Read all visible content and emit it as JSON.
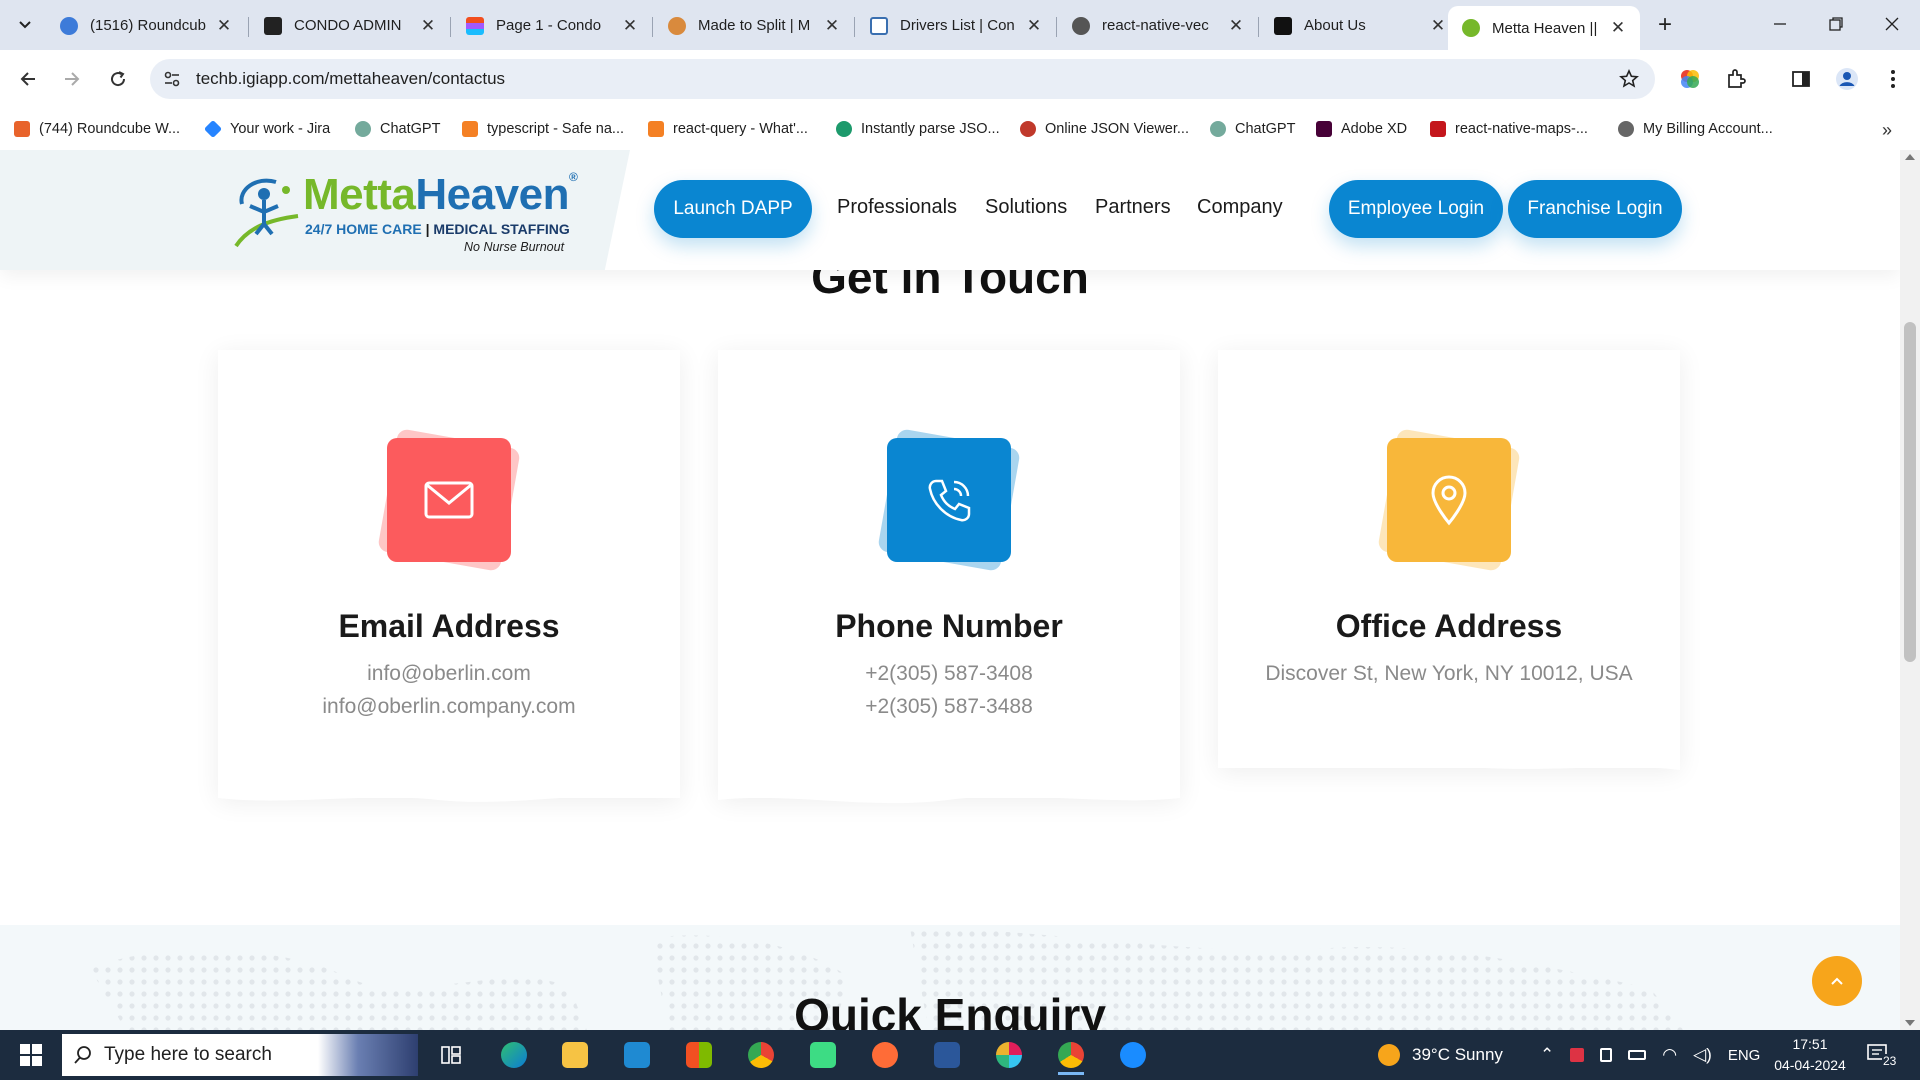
{
  "browser": {
    "tabs": [
      {
        "title": "(1516) Roundcub",
        "color": "#3d7bd9"
      },
      {
        "title": "CONDO ADMIN",
        "color": "#222222"
      },
      {
        "title": "Page 1 - Condo",
        "color": "#f24e1e"
      },
      {
        "title": "Made to Split | M",
        "color": "#d98a3d"
      },
      {
        "title": "Drivers List | Con",
        "color": "#3a6fb0"
      },
      {
        "title": "react-native-vec",
        "color": "#555555"
      },
      {
        "title": "About Us",
        "color": "#111111"
      },
      {
        "title": "Metta Heaven ||",
        "color": "#76b82a",
        "active": true
      }
    ],
    "url": "techb.igiapp.com/mettaheaven/contactus",
    "bookmarks": [
      {
        "label": "(744) Roundcube W...",
        "color": "#e8632b"
      },
      {
        "label": "Your work - Jira",
        "color": "#2684ff"
      },
      {
        "label": "ChatGPT",
        "color": "#74aa9c"
      },
      {
        "label": "typescript - Safe na...",
        "color": "#f48024"
      },
      {
        "label": "react-query - What'...",
        "color": "#f48024"
      },
      {
        "label": "Instantly parse JSO...",
        "color": "#1d9a6c"
      },
      {
        "label": "Online JSON Viewer...",
        "color": "#c0392b"
      },
      {
        "label": "ChatGPT",
        "color": "#74aa9c"
      },
      {
        "label": "Adobe XD",
        "color": "#470137"
      },
      {
        "label": "react-native-maps-...",
        "color": "#c4161c"
      },
      {
        "label": "My Billing Account...",
        "color": "#666666"
      }
    ]
  },
  "site": {
    "logo": {
      "brand_part1": "Metta",
      "brand_part2": "Heaven",
      "reg": "®",
      "tagline_part1": "24/7 HOME CARE",
      "tagline_sep": "|",
      "tagline_part2": "MEDICAL STAFFING",
      "sub": "No Nurse Burnout"
    },
    "nav": {
      "launch": "Launch DAPP",
      "links": [
        "Professionals",
        "Solutions",
        "Partners",
        "Company"
      ],
      "employee_login": "Employee Login",
      "franchise_login": "Franchise Login"
    },
    "section_title": "Get in Touch",
    "cards": [
      {
        "title": "Email Address",
        "lines": [
          "info@oberlin.com",
          "info@oberlin.company.com"
        ],
        "color": "#fc5b5d",
        "icon": "mail-icon"
      },
      {
        "title": "Phone Number",
        "lines": [
          "+2(305) 587-3408",
          "+2(305) 587-3488"
        ],
        "color": "#0a86d1",
        "icon": "phone-icon"
      },
      {
        "title": "Office Address",
        "lines": [
          "Discover St, New York, NY 10012, USA"
        ],
        "color": "#f8b73a",
        "icon": "location-pin-icon"
      }
    ],
    "enquiry_title": "Quick Enquiry"
  },
  "taskbar": {
    "search_placeholder": "Type here to search",
    "weather": "39°C  Sunny",
    "lang": "ENG",
    "time": "17:51",
    "date": "04-04-2024",
    "notif_count": "23"
  }
}
